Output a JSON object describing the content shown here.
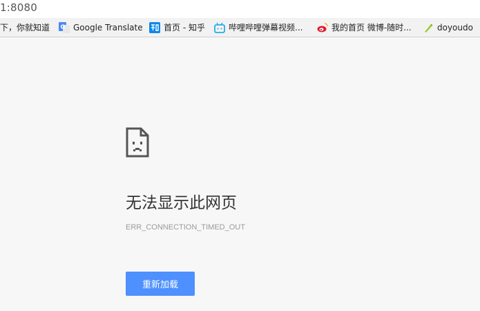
{
  "address_bar": {
    "url": "1:8080"
  },
  "bookmarks": [
    {
      "label": "下，你就知道",
      "icon": "none"
    },
    {
      "label": "Google Translate",
      "icon": "google-translate-icon"
    },
    {
      "label": "首页 - 知乎",
      "icon": "zhihu-icon"
    },
    {
      "label": "哔哩哔哩弹幕视频...",
      "icon": "bilibili-icon"
    },
    {
      "label": "我的首页 微博-随时...",
      "icon": "weibo-icon"
    },
    {
      "label": "doyoudo",
      "icon": "doyoudo-icon"
    }
  ],
  "error_page": {
    "icon": "sad-page-icon",
    "title": "无法显示此网页",
    "error_code": "ERR_CONNECTION_TIMED_OUT",
    "reload_label": "重新加载",
    "button_color": "#4d90fe"
  }
}
